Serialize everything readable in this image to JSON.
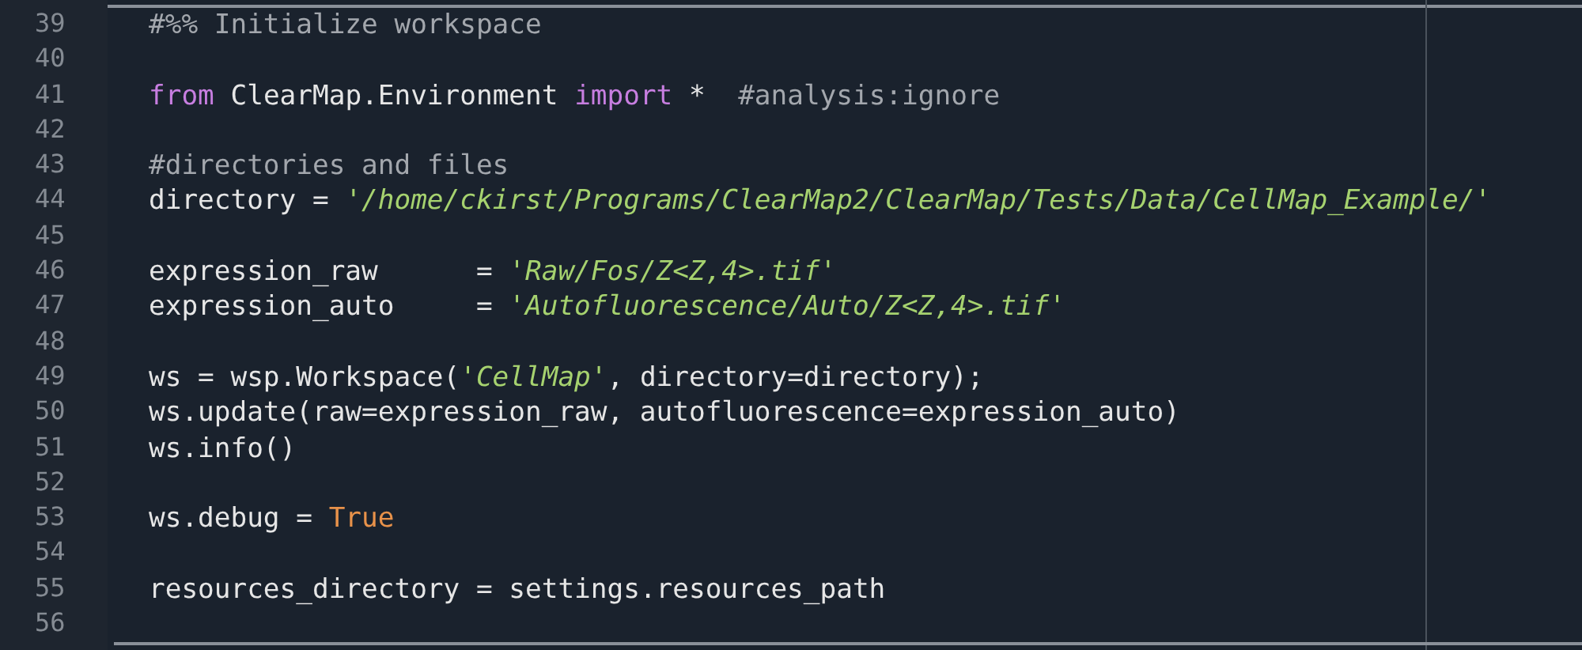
{
  "editor": {
    "lines": [
      {
        "number": "39",
        "tokens": [
          {
            "kind": "comment",
            "text": "#%% Initialize workspace"
          }
        ]
      },
      {
        "number": "40"
      },
      {
        "number": "41",
        "tokens": [
          {
            "kind": "keyword",
            "text": "from"
          },
          {
            "kind": "plain",
            "text": " ClearMap.Environment "
          },
          {
            "kind": "keyword",
            "text": "import"
          },
          {
            "kind": "plain",
            "text": " *  "
          },
          {
            "kind": "comment",
            "text": "#analysis:ignore"
          }
        ]
      },
      {
        "number": "42"
      },
      {
        "number": "43",
        "tokens": [
          {
            "kind": "comment",
            "text": "#directories and files"
          }
        ]
      },
      {
        "number": "44",
        "tokens": [
          {
            "kind": "plain",
            "text": "directory = "
          },
          {
            "kind": "string",
            "text": "'/home/ckirst/Programs/ClearMap2/ClearMap/Tests/Data/CellMap_Example/'"
          }
        ]
      },
      {
        "number": "45"
      },
      {
        "number": "46",
        "tokens": [
          {
            "kind": "plain",
            "text": "expression_raw      = "
          },
          {
            "kind": "string",
            "text": "'Raw/Fos/Z<Z,4>.tif'"
          }
        ]
      },
      {
        "number": "47",
        "tokens": [
          {
            "kind": "plain",
            "text": "expression_auto     = "
          },
          {
            "kind": "string",
            "text": "'Autofluorescence/Auto/Z<Z,4>.tif'"
          }
        ]
      },
      {
        "number": "48"
      },
      {
        "number": "49",
        "tokens": [
          {
            "kind": "plain",
            "text": "ws = wsp.Workspace("
          },
          {
            "kind": "string",
            "text": "'CellMap'"
          },
          {
            "kind": "plain",
            "text": ", directory=directory);"
          }
        ]
      },
      {
        "number": "50",
        "tokens": [
          {
            "kind": "plain",
            "text": "ws.update(raw=expression_raw, autofluorescence=expression_auto)"
          }
        ]
      },
      {
        "number": "51",
        "tokens": [
          {
            "kind": "plain",
            "text": "ws.info()"
          }
        ]
      },
      {
        "number": "52"
      },
      {
        "number": "53",
        "tokens": [
          {
            "kind": "plain",
            "text": "ws.debug = "
          },
          {
            "kind": "constant",
            "text": "True"
          }
        ]
      },
      {
        "number": "54"
      },
      {
        "number": "55",
        "tokens": [
          {
            "kind": "plain",
            "text": "resources_directory = settings.resources_path"
          }
        ]
      },
      {
        "number": "56"
      }
    ]
  }
}
